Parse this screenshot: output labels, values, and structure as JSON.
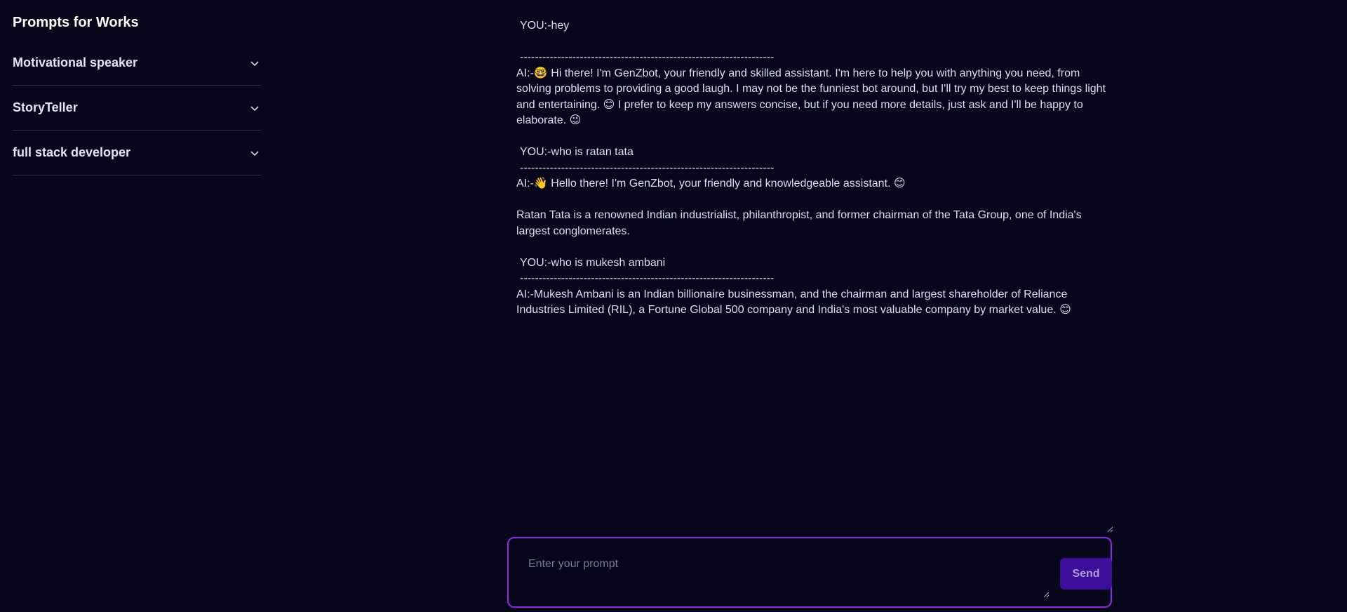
{
  "sidebar": {
    "title": "Prompts for Works",
    "items": [
      {
        "label": "Motivational speaker",
        "icon": "chevron-down-icon"
      },
      {
        "label": "StoryTeller",
        "icon": "chevron-down-icon"
      },
      {
        "label": "full stack developer",
        "icon": "chevron-down-icon"
      }
    ]
  },
  "chat": {
    "separator": "--------------------------------------------------------------------",
    "messages": [
      {
        "you": "YOU:-hey",
        "ai": "AI:-🤓 Hi there! I'm GenZbot, your friendly and skilled assistant. I'm here to help you with anything you need, from solving problems to providing a good laugh. I may not be the funniest bot around, but I'll try my best to keep things light and entertaining. 😊 I prefer to keep my answers concise, but if you need more details, just ask and I'll be happy to elaborate. 😉"
      },
      {
        "you": "YOU:-who is ratan tata",
        "ai": "AI:-👋 Hello there! I'm GenZbot, your friendly and knowledgeable assistant. 😊",
        "ai_extra": "Ratan Tata is a renowned Indian industrialist, philanthropist, and former chairman of the Tata Group, one of India's largest conglomerates."
      },
      {
        "you": "YOU:-who is mukesh ambani",
        "ai": "AI:-Mukesh Ambani is an Indian billionaire businessman, and the chairman and largest shareholder of Reliance Industries Limited (RIL), a Fortune Global 500 company and India's most valuable company by market value.  😊"
      }
    ]
  },
  "composer": {
    "placeholder": "Enter your prompt",
    "value": "",
    "send_label": "Send"
  },
  "colors": {
    "background": "#07061a",
    "accent_border": "#8b2ce0",
    "send_button": "#3c0e9a"
  }
}
